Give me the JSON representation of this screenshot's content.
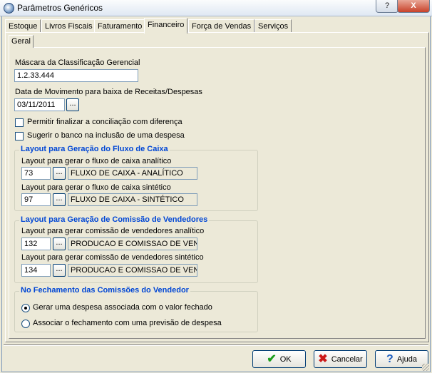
{
  "window": {
    "title": "Parâmetros Genéricos",
    "help_label": "?",
    "close_label": "X"
  },
  "tabs": [
    "Estoque",
    "Livros Fiscais",
    "Faturamento",
    "Financeiro",
    "Força de Vendas",
    "Serviços"
  ],
  "active_tab": "Financeiro",
  "subtab": "Geral",
  "form": {
    "mascara_label": "Máscara da Classificação Gerencial",
    "mascara_value": "1.2.33.444",
    "data_label": "Data de Movimento para baixa de Receitas/Despesas",
    "data_value": "03/11/2011",
    "lookup_label": "...",
    "chk_conciliacao": {
      "label": "Permitir finalizar a conciliação com diferença",
      "checked": false
    },
    "chk_sugerir": {
      "label": "Sugerir o banco na inclusão de uma despesa",
      "checked": false
    }
  },
  "group_fluxo": {
    "title": "Layout para Geração do Fluxo de Caixa",
    "analitico_label": "Layout para gerar o fluxo de caixa analítico",
    "analitico_code": "73",
    "analitico_desc": "FLUXO DE CAIXA - ANALÍTICO",
    "sintetico_label": "Layout para gerar o fluxo de caixa sintético",
    "sintetico_code": "97",
    "sintetico_desc": "FLUXO DE CAIXA - SINTÉTICO"
  },
  "group_comissao": {
    "title": "Layout para Geração de Comissão de Vendedores",
    "analitico_label": "Layout para gerar comissão de vendedores analítico",
    "analitico_code": "132",
    "analitico_desc": "PRODUCAO E COMISSAO DE VEND",
    "sintetico_label": "Layout para gerar comissão de vendedores sintético",
    "sintetico_code": "134",
    "sintetico_desc": "PRODUCAO E COMISSAO DE VEND"
  },
  "group_fechamento": {
    "title": "No Fechamento das Comissões do Vendedor",
    "opt_despesa": {
      "label": "Gerar uma despesa associada com o valor fechado",
      "selected": true
    },
    "opt_previsao": {
      "label": "Associar o fechamento com uma previsão de despesa",
      "selected": false
    }
  },
  "buttons": {
    "ok": "OK",
    "cancelar": "Cancelar",
    "ajuda": "Ajuda"
  },
  "colors": {
    "group_title": "#0046d5",
    "ok_icon": "#1a9c1a",
    "cancel_icon": "#cc1a1a",
    "help_icon": "#1f5fbf"
  },
  "icons": {
    "ok": "check-icon",
    "cancel": "x-icon",
    "help": "question-icon"
  }
}
